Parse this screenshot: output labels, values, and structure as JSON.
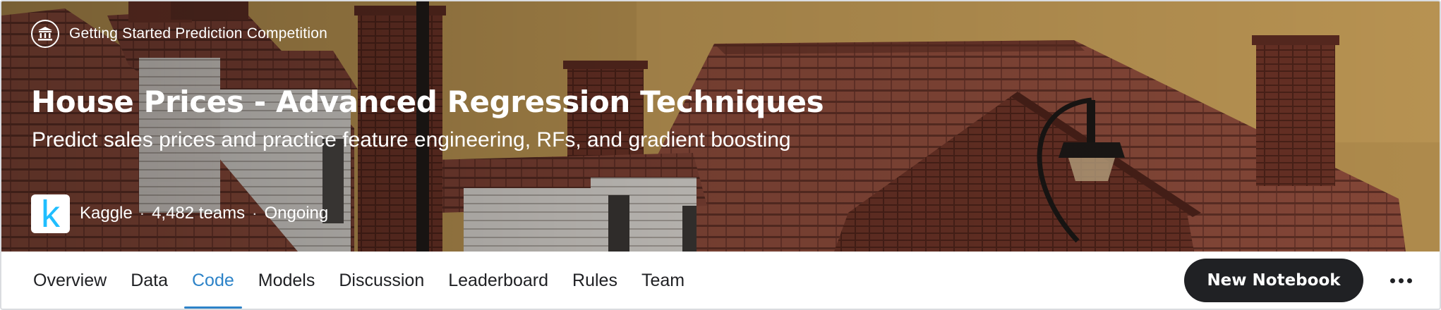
{
  "header": {
    "host_type": "Getting Started Prediction Competition",
    "host_icon": "bank-icon",
    "title": "House Prices - Advanced Regression Techniques",
    "subtitle": "Predict sales prices and practice feature engineering, RFs, and gradient boosting",
    "organization": "Kaggle",
    "organization_logo_letter": "k",
    "teams": "4,482 teams",
    "status": "Ongoing",
    "separator": "·"
  },
  "tabs": [
    {
      "label": "Overview",
      "active": false
    },
    {
      "label": "Data",
      "active": false
    },
    {
      "label": "Code",
      "active": true
    },
    {
      "label": "Models",
      "active": false
    },
    {
      "label": "Discussion",
      "active": false
    },
    {
      "label": "Leaderboard",
      "active": false
    },
    {
      "label": "Rules",
      "active": false
    },
    {
      "label": "Team",
      "active": false
    }
  ],
  "actions": {
    "new_notebook_label": "New Notebook",
    "more_icon": "more-horizontal-icon"
  },
  "colors": {
    "active_tab": "#2d83c8",
    "button_bg": "#202124",
    "kaggle_blue": "#20beff"
  }
}
